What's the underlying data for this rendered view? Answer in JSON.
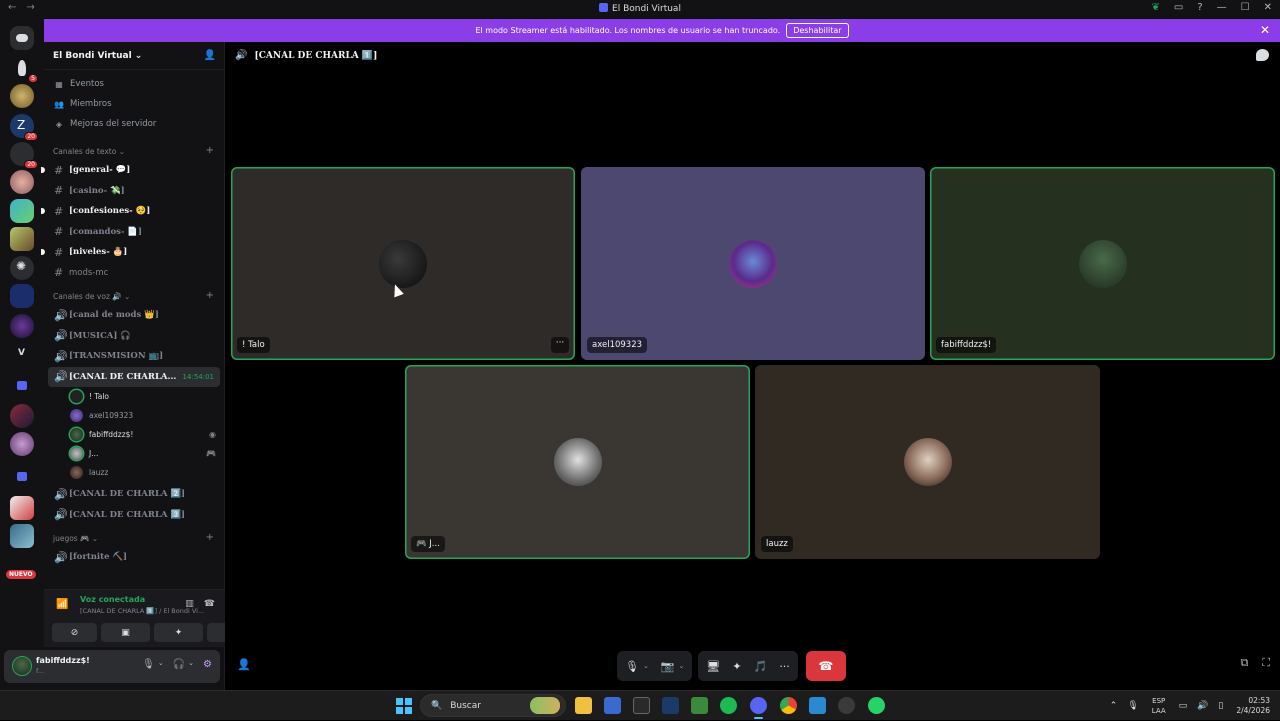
{
  "titlebar": {
    "back": "←",
    "forward": "→",
    "title": "El Bondi Virtual",
    "icons": [
      "leaf-icon",
      "inbox-icon",
      "help-icon"
    ],
    "window_controls": [
      "—",
      "☐",
      "✕"
    ]
  },
  "streamer_banner": {
    "text": "El modo Streamer está habilitado. Los nombres de usuario se han truncado.",
    "button": "Deshabilitar",
    "close": "✕"
  },
  "server_rail": {
    "nuevo": "NUEVO",
    "badges": [
      "5",
      "20",
      "20"
    ],
    "letter_v": "V"
  },
  "sidebar": {
    "guild_name": "El Bondi Virtual ⌄",
    "menu": [
      {
        "label": "Eventos",
        "icon": "calendar-icon"
      },
      {
        "label": "Miembros",
        "icon": "members-icon"
      },
      {
        "label": "Mejoras del servidor",
        "icon": "boost-icon"
      }
    ],
    "text_category": "Canales de texto ⌄",
    "text_channels": [
      {
        "name": "[general- 💬]",
        "unread": true
      },
      {
        "name": "[casino- 💸]",
        "unread": false
      },
      {
        "name": "[confesiones- 🥺]",
        "unread": true
      },
      {
        "name": "[comandos- 📄]",
        "unread": false
      },
      {
        "name": "[niveles- 🎂]",
        "unread": true
      },
      {
        "name": "mods-mc",
        "unread": false
      }
    ],
    "voice_category": "Canales de voz 🔊 ⌄",
    "voice_channels_top": [
      {
        "name": "[canal de mods 👑]"
      },
      {
        "name": "[MUSICA] 🎧"
      },
      {
        "name": "[TRANSMISION 📺]"
      }
    ],
    "active_channel": {
      "name": "[CANAL DE CHARLA...",
      "time": "14:54:01"
    },
    "members": [
      {
        "name": "! Talo",
        "status": ""
      },
      {
        "name": "axel109323",
        "status": ""
      },
      {
        "name": "fabiffddzz$!",
        "status": "◉"
      },
      {
        "name": "J...",
        "status": "🎮"
      },
      {
        "name": "lauzz",
        "status": ""
      }
    ],
    "voice_channels_bottom": [
      {
        "name": "[CANAL DE CHARLA 2️⃣]"
      },
      {
        "name": "[CANAL DE CHARLA 3️⃣]"
      }
    ],
    "games_category": "juegos 🎮 ⌄",
    "games_channels": [
      {
        "name": "[fortnite ⛏️]"
      }
    ]
  },
  "voice_panel": {
    "status": "Voz conectada",
    "channel": "[CANAL DE CHARLA 1️⃣] / El Bondi Vi..."
  },
  "user_panel": {
    "username": "fabiffddzz$!",
    "subtext": "f..."
  },
  "stage": {
    "header": "[CANAL DE CHARLA 1️⃣]",
    "tiles": [
      {
        "label": "! Talo",
        "speaking": true
      },
      {
        "label": "axel109323",
        "speaking": false
      },
      {
        "label": "fabiffddzz$!",
        "speaking": true
      },
      {
        "label": "🎮 J...",
        "speaking": true
      },
      {
        "label": "lauzz",
        "speaking": false
      }
    ],
    "tile_more": "···"
  },
  "controls": {
    "mic": "🎙",
    "camera": "📷",
    "share": "🖥",
    "activities": "✦",
    "soundboard": "🎵",
    "more": "···",
    "hangup": "☎"
  },
  "taskbar": {
    "search": "Buscar",
    "lang_line1": "ESP",
    "lang_line2": "LAA",
    "time": "02:53",
    "date": "2/4/2026"
  },
  "colors": {
    "accent_green": "#23a55a",
    "streamer_purple": "#8b3ee8",
    "hangup_red": "#da373c"
  }
}
